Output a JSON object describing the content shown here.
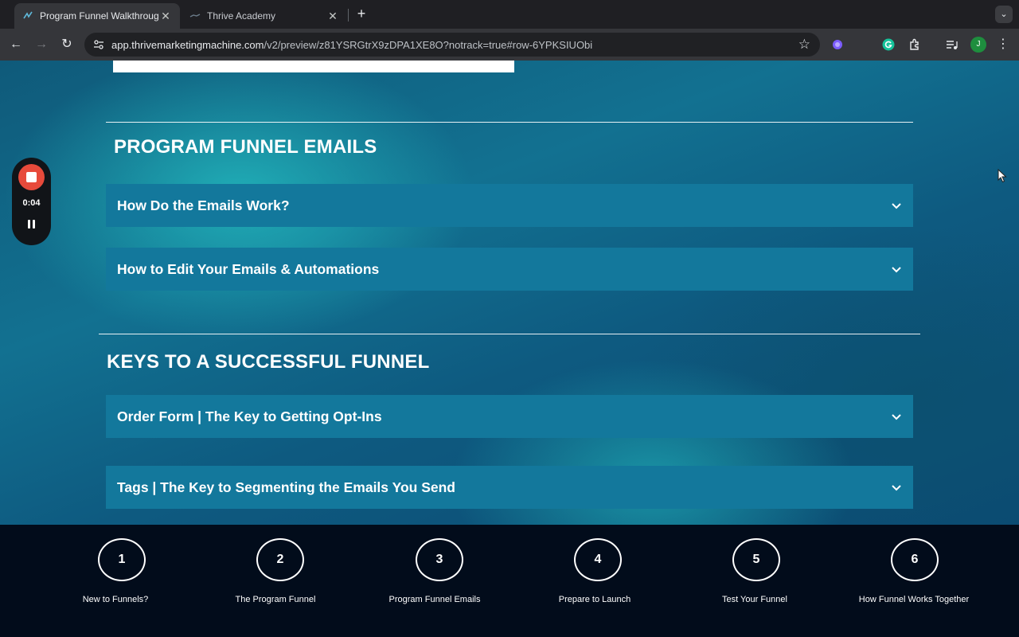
{
  "browser": {
    "tabs": [
      {
        "title": "Program Funnel Walkthrough",
        "active": true
      },
      {
        "title": "Thrive Academy",
        "active": false
      }
    ],
    "url_host": "app.thrivemarketingmachine.com",
    "url_path": "/v2/preview/z81YSRGtrX9zDPA1XE8O?notrack=true#row-6YPKSIUObi",
    "profile_initial": "J",
    "accent_colors": {
      "toolbar": "#35363a",
      "tabbar": "#1f1f23",
      "profile": "#1e8e3e"
    }
  },
  "recorder": {
    "elapsed": "0:04",
    "stop_color": "#e74a3b"
  },
  "sections": [
    {
      "title": "PROGRAM FUNNEL EMAILS",
      "items": [
        "How Do the Emails Work?",
        "How to Edit Your Emails & Automations"
      ]
    },
    {
      "title": "KEYS TO A SUCCESSFUL FUNNEL",
      "items": [
        "Order Form | The Key to Getting Opt-Ins",
        "Tags | The Key to Segmenting the Emails You Send"
      ]
    }
  ],
  "steps": [
    {
      "number": "1",
      "label": "New to Funnels?"
    },
    {
      "number": "2",
      "label": "The Program Funnel"
    },
    {
      "number": "3",
      "label": "Program Funnel Emails"
    },
    {
      "number": "4",
      "label": "Prepare to Launch"
    },
    {
      "number": "5",
      "label": "Test Your Funnel"
    },
    {
      "number": "6",
      "label": "How Funnel Works Together"
    }
  ],
  "theme": {
    "accordion_bg": "#13789c",
    "steps_bg": "#020c1b",
    "text": "#ffffff"
  }
}
